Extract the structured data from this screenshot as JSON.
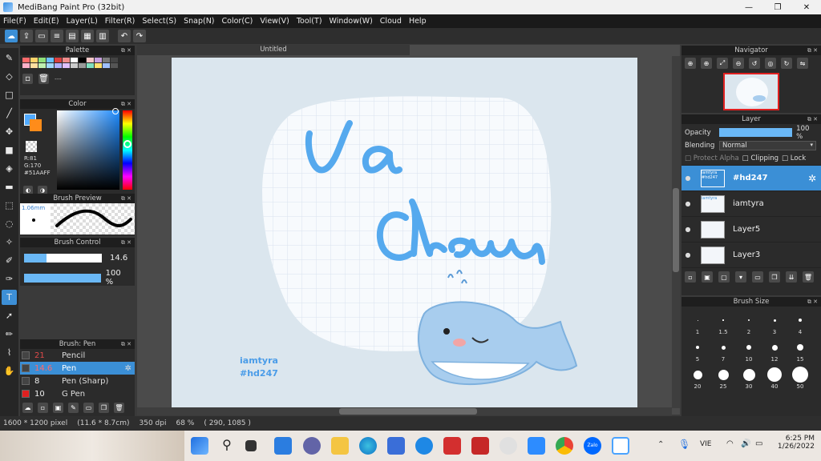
{
  "window": {
    "title": "MediBang Paint Pro (32bit)",
    "min": "—",
    "max": "❐",
    "close": "✕"
  },
  "menu": [
    "File(F)",
    "Edit(E)",
    "Layer(L)",
    "Filter(R)",
    "Select(S)",
    "Snap(N)",
    "Color(C)",
    "View(V)",
    "Tool(T)",
    "Window(W)",
    "Cloud",
    "Help"
  ],
  "panels": {
    "palette": "Palette",
    "palette_add": "---",
    "color": "Color",
    "brush_preview": "Brush Preview",
    "brush_control": "Brush Control",
    "brush_list": "Brush: Pen",
    "navigator": "Navigator",
    "layer": "Layer",
    "brush_size": "Brush Size"
  },
  "color": {
    "primary": "#51AAFF",
    "r": "R:81",
    "g": "G:170",
    "hex": "#51AAFF"
  },
  "brush_preview": {
    "size": "1.06mm"
  },
  "brush_control": {
    "size": "14.6",
    "opacity": "100 %"
  },
  "brushes": [
    {
      "num": "21",
      "name": "Pencil",
      "color": "#e04a4a",
      "selected": false
    },
    {
      "num": "14.6",
      "name": "Pen",
      "color": "#e04a4a",
      "selected": true
    },
    {
      "num": "8",
      "name": "Pen (Sharp)",
      "color": "#dddddd",
      "selected": false
    },
    {
      "num": "10",
      "name": "G Pen",
      "color": "#dddddd",
      "selected": false
    }
  ],
  "canvas": {
    "tab": "Untitled",
    "text1": "Va",
    "text2": "chrw",
    "watermark1": "iamtyra",
    "watermark2": "#hd247"
  },
  "layer": {
    "opacity_label": "Opacity",
    "opacity_value": "100 %",
    "blending_label": "Blending",
    "blending_value": "Normal",
    "protect_alpha": "Protect Alpha",
    "clipping": "Clipping",
    "lock": "Lock",
    "layers": [
      {
        "name": "#hd247",
        "thumb": "iamtyra #hd247",
        "selected": true
      },
      {
        "name": "iamtyra",
        "thumb": "iamtyra",
        "selected": false
      },
      {
        "name": "Layer5",
        "thumb": "",
        "selected": false
      },
      {
        "name": "Layer3",
        "thumb": "",
        "selected": false
      }
    ]
  },
  "brush_sizes": [
    "1",
    "1.5",
    "2",
    "3",
    "4",
    "5",
    "7",
    "10",
    "12",
    "15",
    "20",
    "25",
    "30",
    "40",
    "50"
  ],
  "status": {
    "dims": "1600 * 1200 pixel",
    "physical": "(11.6 * 8.7cm)",
    "dpi": "350 dpi",
    "zoom": "68 %",
    "coords": "( 290, 1085 )"
  },
  "taskbar": {
    "lang": "VIE",
    "time": "6:25 PM",
    "date": "1/26/2022",
    "zalo": "Zalo"
  }
}
